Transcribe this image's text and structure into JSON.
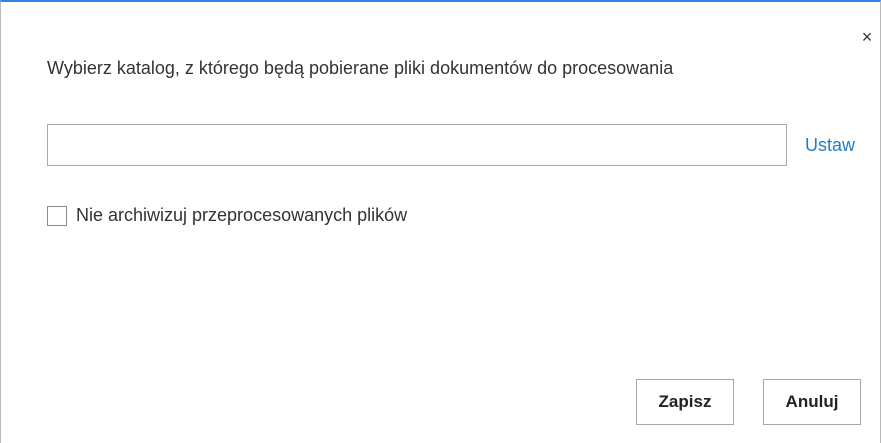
{
  "dialog": {
    "close_symbol": "×",
    "prompt": "Wybierz katalog, z którego będą pobierane pliki dokumentów do procesowania",
    "path_input": {
      "value": "",
      "placeholder": ""
    },
    "set_link_label": "Ustaw",
    "archive_checkbox": {
      "label": "Nie archiwizuj przeprocesowanych plików",
      "checked": false
    },
    "buttons": {
      "save_label": "Zapisz",
      "cancel_label": "Anuluj"
    }
  },
  "colors": {
    "accent_border": "#2e86de",
    "link": "#1e7ec8"
  },
  "icons": {
    "close": "close-icon"
  }
}
